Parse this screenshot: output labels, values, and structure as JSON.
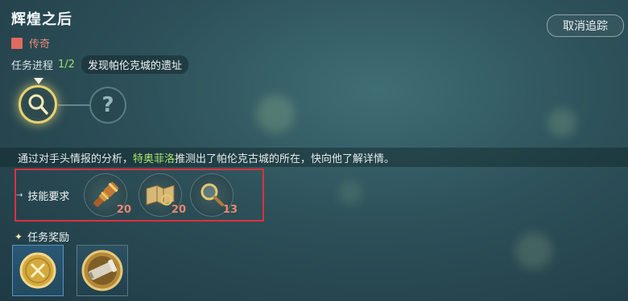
{
  "quest": {
    "title": "辉煌之后",
    "rarity": "传奇",
    "rarity_color": "#e06a5f"
  },
  "untrack_button": "取消追踪",
  "progress": {
    "label": "任务进程",
    "count": "1/2",
    "current_step": "发现帕伦克城的遗址",
    "locked_step_glyph": "?"
  },
  "description": {
    "before": "通过对手头情报的分析，",
    "highlight": "特奥菲洛",
    "after": "推测出了帕伦克古城的所在，快向他了解详情。"
  },
  "skills": {
    "label": "技能要求",
    "items": [
      {
        "icon": "spyglass-icon",
        "level": "20"
      },
      {
        "icon": "map-icon",
        "level": "20"
      },
      {
        "icon": "magnifier-icon",
        "level": "13"
      }
    ]
  },
  "rewards": {
    "label": "任务奖励",
    "items": [
      {
        "icon": "gold-coin-icon"
      },
      {
        "icon": "telescope-medal-icon"
      }
    ]
  },
  "colors": {
    "highlight": "#a8e36c",
    "skill_level": "#e9876f",
    "active_glow": "#e8d270"
  }
}
